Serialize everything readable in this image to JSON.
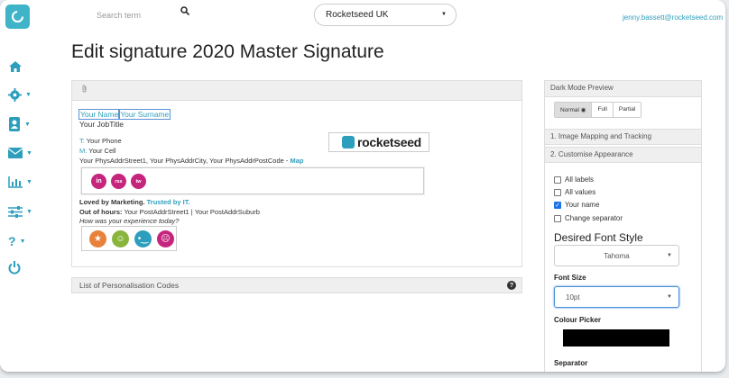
{
  "search": {
    "placeholder": "Search term"
  },
  "account": {
    "selected": "Rocketseed UK"
  },
  "user": {
    "email": "jenny.bassett@rocketseed.com"
  },
  "page": {
    "title": "Edit signature 2020 Master Signature"
  },
  "sidebar": {
    "items": [
      "home-icon",
      "settings-icon",
      "contacts-icon",
      "mail-icon",
      "reports-icon",
      "filters-icon",
      "help-icon",
      "logout-icon"
    ],
    "accent": "#2d9fbd"
  },
  "signature": {
    "first_name": "Your Name",
    "surname": "Your Surname",
    "job_title": "Your JobTitle",
    "phone_prefix": "T:",
    "phone": "Your Phone",
    "cell_prefix": "M:",
    "cell": "Your Cell",
    "address": "Your PhysAddrStreet1, Your PhysAddrCity, Your PhysAddrPostCode - ",
    "map_link": "Map",
    "logo_text": "rocketseed",
    "social": [
      "in",
      "rss",
      "tw"
    ],
    "loved": "Loved by Marketing. ",
    "trusted": "Trusted by IT.",
    "ooh_label": "Out of hours:",
    "ooh_value": " Your PostAddrStreet1 | Your PostAddrSuburb",
    "question": "How was your experience today?",
    "feedback_colors": [
      "#e8813a",
      "#8ab53d",
      "#2d9fbd",
      "#c6257e"
    ]
  },
  "codes": {
    "label": "List of Personalisation Codes"
  },
  "right": {
    "dark_mode": "Dark Mode Preview",
    "modes": [
      "Normal",
      "Full",
      "Partial"
    ],
    "section1": "1. Image Mapping and Tracking",
    "section2": "2. Customise Appearance",
    "checks": [
      {
        "label": "All labels",
        "checked": false
      },
      {
        "label": "All values",
        "checked": false
      },
      {
        "label": "Your name",
        "checked": true
      },
      {
        "label": "Change separator",
        "checked": false
      }
    ],
    "font_style_label": "Desired Font Style",
    "font_style_value": "Tahoma",
    "font_size_label": "Font Size",
    "font_size_value": "10pt",
    "colour_label": "Colour Picker",
    "colour_value": "#000000",
    "separator_label": "Separator"
  }
}
